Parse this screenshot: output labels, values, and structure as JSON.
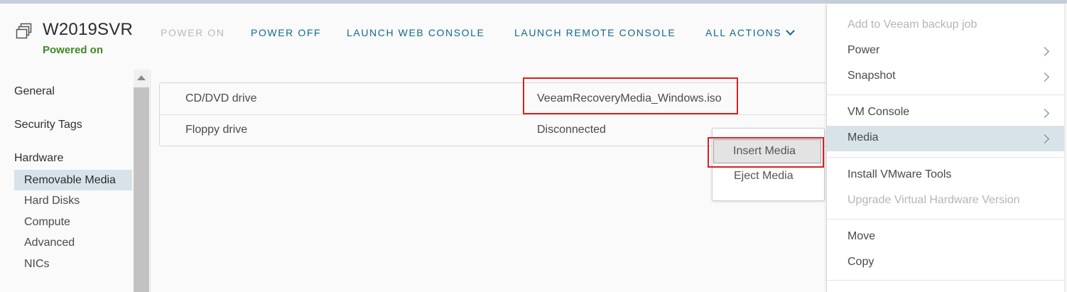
{
  "vm": {
    "name": "W2019SVR",
    "state": "Powered on"
  },
  "actions": {
    "power_on": "POWER ON",
    "power_off": "POWER OFF",
    "launch_web_console": "LAUNCH WEB CONSOLE",
    "launch_remote_console": "LAUNCH REMOTE CONSOLE",
    "all_actions": "ALL ACTIONS"
  },
  "nav": {
    "general": "General",
    "security_tags": "Security Tags",
    "hardware": "Hardware",
    "sub": [
      "Removable Media",
      "Hard Disks",
      "Compute",
      "Advanced",
      "NICs"
    ]
  },
  "table": {
    "rows": [
      {
        "device": "CD/DVD drive",
        "value": "VeeamRecoveryMedia_Windows.iso"
      },
      {
        "device": "Floppy drive",
        "value": "Disconnected"
      }
    ]
  },
  "media_submenu": {
    "insert": "Insert Media",
    "eject": "Eject Media"
  },
  "context_menu": {
    "add_to_veeam": "Add to Veeam backup job",
    "power": "Power",
    "snapshot": "Snapshot",
    "vm_console": "VM Console",
    "media": "Media",
    "install_tools": "Install VMware Tools",
    "upgrade_hw": "Upgrade Virtual Hardware Version",
    "move": "Move",
    "copy": "Copy"
  },
  "colors": {
    "accent": "#0f6a8f",
    "state_green": "#3c8a21",
    "highlight_red": "#d9201f",
    "selected_bg": "#d8e3e9"
  }
}
